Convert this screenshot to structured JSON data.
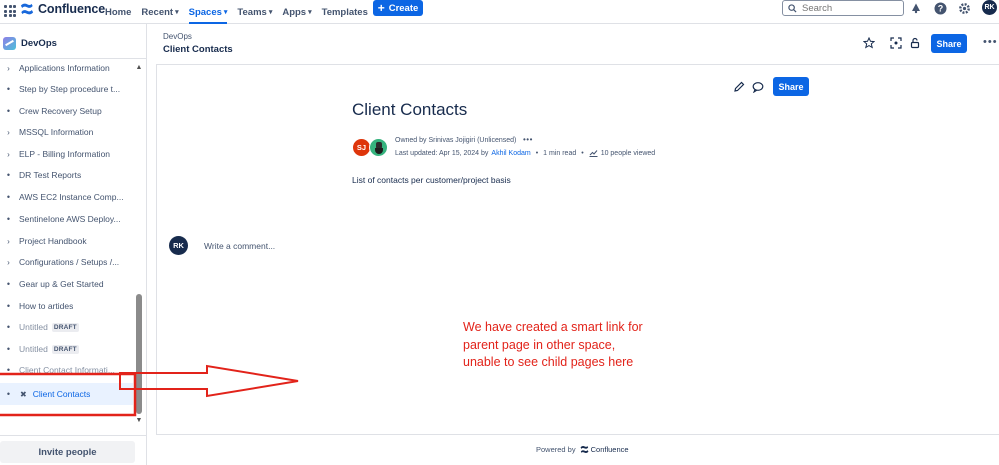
{
  "topnav": {
    "app_name": "Confluence",
    "items": [
      {
        "label": "Home",
        "dropdown": false,
        "active": false
      },
      {
        "label": "Recent",
        "dropdown": true,
        "active": false
      },
      {
        "label": "Spaces",
        "dropdown": true,
        "active": true
      },
      {
        "label": "Teams",
        "dropdown": true,
        "active": false
      },
      {
        "label": "Apps",
        "dropdown": true,
        "active": false
      },
      {
        "label": "Templates",
        "dropdown": false,
        "active": false
      }
    ],
    "create_label": "Create",
    "search_placeholder": "Search",
    "user_initials": "RK",
    "icons": [
      "app-switcher-icon",
      "notifications-icon",
      "help-icon",
      "settings-icon"
    ]
  },
  "sidebar": {
    "space_name": "DevOps",
    "items": [
      {
        "label": "Applications Information",
        "type": "expand"
      },
      {
        "label": "Step by Step procedure t...",
        "type": "dot"
      },
      {
        "label": "Crew Recovery Setup",
        "type": "dot"
      },
      {
        "label": "MSSQL Information",
        "type": "expand"
      },
      {
        "label": "ELP - Billing Information",
        "type": "expand"
      },
      {
        "label": "DR Test Reports",
        "type": "dot"
      },
      {
        "label": "AWS EC2 Instance Comp...",
        "type": "dot"
      },
      {
        "label": "SentineIone AWS Deploy...",
        "type": "dot"
      },
      {
        "label": "Project Handbook",
        "type": "expand"
      },
      {
        "label": "Configurations / Setups /...",
        "type": "expand"
      },
      {
        "label": "Gear up & Get Started",
        "type": "dot"
      },
      {
        "label": "How to artides",
        "type": "dot"
      },
      {
        "label": "Untitled",
        "type": "dot",
        "badge": "DRAFT",
        "muted": true
      },
      {
        "label": "Untitled",
        "type": "dot",
        "badge": "DRAFT",
        "muted": true
      },
      {
        "label": "Client Contact Informati...",
        "type": "dot",
        "muted": true
      },
      {
        "label": "Client Contacts",
        "type": "selected"
      }
    ],
    "invite_label": "Invite people"
  },
  "header": {
    "breadcrumb": "DevOps",
    "title": "Client Contacts",
    "share_label": "Share"
  },
  "page": {
    "share_label": "Share",
    "title": "Client Contacts",
    "owner_text": "Owned by Srinivas Jojigiri (Unlicensed)",
    "owner_initials": "SJ",
    "updated_prefix": "Last updated: Apr 15, 2024 by",
    "updated_by": "Akhil Kodam",
    "read_time": "1 min read",
    "views": "10 people viewed",
    "body": "List of contacts per customer/project basis",
    "comment_avatar": "RK",
    "comment_placeholder": "Write a comment..."
  },
  "annotation": {
    "lines": [
      "We have created a smart link for",
      "parent page in other space,",
      "unable to see child pages here"
    ],
    "color": "#e2231a"
  },
  "footer": {
    "powered_by": "Powered by",
    "brand": "Confluence"
  },
  "colors": {
    "accent": "#0c66e4",
    "text": "#172b4d",
    "subtle": "#44546f"
  }
}
